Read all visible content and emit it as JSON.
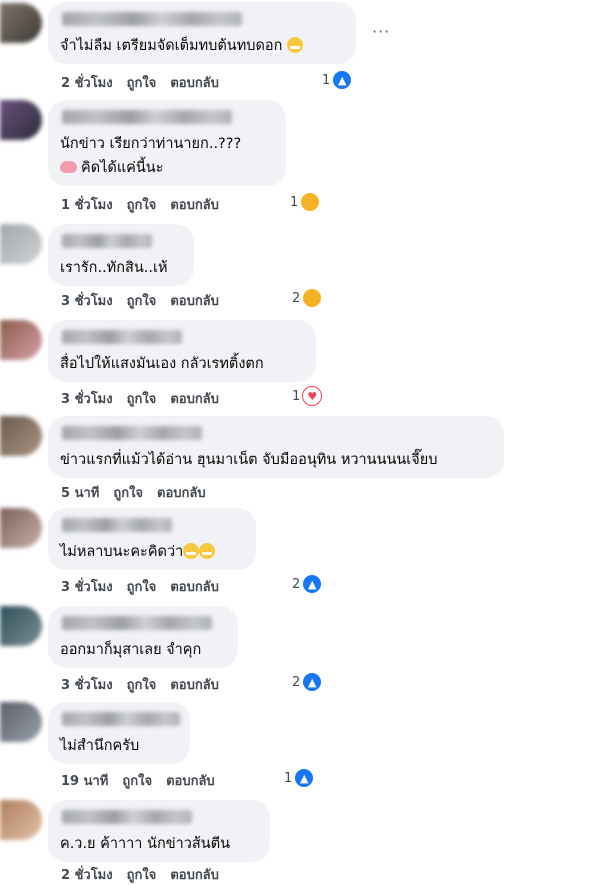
{
  "comments": [
    {
      "lines": [
        "จำไม่ลืม เตรียมจัดเต็มทบต้นทบดอก"
      ],
      "emoji_after": "grin",
      "time": "2 ชั่วโมง",
      "like": "ถูกใจ",
      "reply": "ตอบกลับ",
      "count": "1",
      "reaction": "like",
      "avatar": [
        "#7e756b",
        "#3f3a36"
      ]
    },
    {
      "lines": [
        "นักข่าว เรียกว่าท่านายก..???",
        "คิดได้แค่นี้นะ"
      ],
      "emoji_before_line2": "brain",
      "time": "1 ชั่วโมง",
      "like": "ถูกใจ",
      "reply": "ตอบกลับ",
      "count": "1",
      "reaction": "haha",
      "avatar": [
        "#6b4f7d",
        "#2b2e3b"
      ]
    },
    {
      "lines": [
        "เรารัก..ทักสิน..เห้"
      ],
      "time": "3 ชั่วโมง",
      "like": "ถูกใจ",
      "reply": "ตอบกลับ",
      "count": "2",
      "reaction": "haha",
      "avatar": [
        "#a5a8ab",
        "#cfd2d4"
      ]
    },
    {
      "lines": [
        "สื่อไปให้แสงมันเอง กลัวเรทติ้งตก"
      ],
      "time": "3 ชั่วโมง",
      "like": "ถูกใจ",
      "reply": "ตอบกลับ",
      "count": "1",
      "reaction": "love",
      "avatar": [
        "#8b5a4a",
        "#d7a1a9"
      ]
    },
    {
      "lines": [
        "ข่าวแรกที่แม้วได้อ่าน ฮุนมาเน็ต จับมืออนุทิน หวานนนนเจี๊ยบ"
      ],
      "time": "5 นาที",
      "like": "ถูกใจ",
      "reply": "ตอบกลับ",
      "count": "",
      "reaction": "",
      "avatar": [
        "#6b5b4e",
        "#a99482"
      ]
    },
    {
      "lines": [
        "ไม่หลาบนะคะคิดว่า"
      ],
      "emoji_after": "grin2",
      "time": "3 ชั่วโมง",
      "like": "ถูกใจ",
      "reply": "ตอบกลับ",
      "count": "2",
      "reaction": "like",
      "avatar": [
        "#7b5f58",
        "#c9b3ad"
      ]
    },
    {
      "lines": [
        "ออกมาก็มุสาเลย จำคุก"
      ],
      "time": "3 ชั่วโมง",
      "like": "ถูกใจ",
      "reply": "ตอบกลับ",
      "count": "2",
      "reaction": "like",
      "avatar": [
        "#2f4f5a",
        "#7c8f95"
      ]
    },
    {
      "lines": [
        "ไม่สำนึกครับ"
      ],
      "time": "19 นาที",
      "like": "ถูกใจ",
      "reply": "ตอบกลับ",
      "count": "1",
      "reaction": "like",
      "avatar": [
        "#5a5f69",
        "#9aa0ab"
      ]
    },
    {
      "lines": [
        "ค.ว.ย ค้าาาา นักข่าวส้นตีน"
      ],
      "time": "2 ชั่วโมง",
      "like": "ถูกใจ",
      "reply": "ตอบกลับ",
      "count": "",
      "reaction": "",
      "avatar": [
        "#b07f5e",
        "#e1c2a9"
      ]
    }
  ],
  "more_label": "···",
  "reaction_glyphs": {
    "like": "👍",
    "love": "♥",
    "haha": "😆"
  },
  "colors": {
    "bubble": "#f0f2f5",
    "meta": "#444950",
    "like": "#1877f2",
    "love": "#f33e58",
    "haha": "#f7b125"
  }
}
